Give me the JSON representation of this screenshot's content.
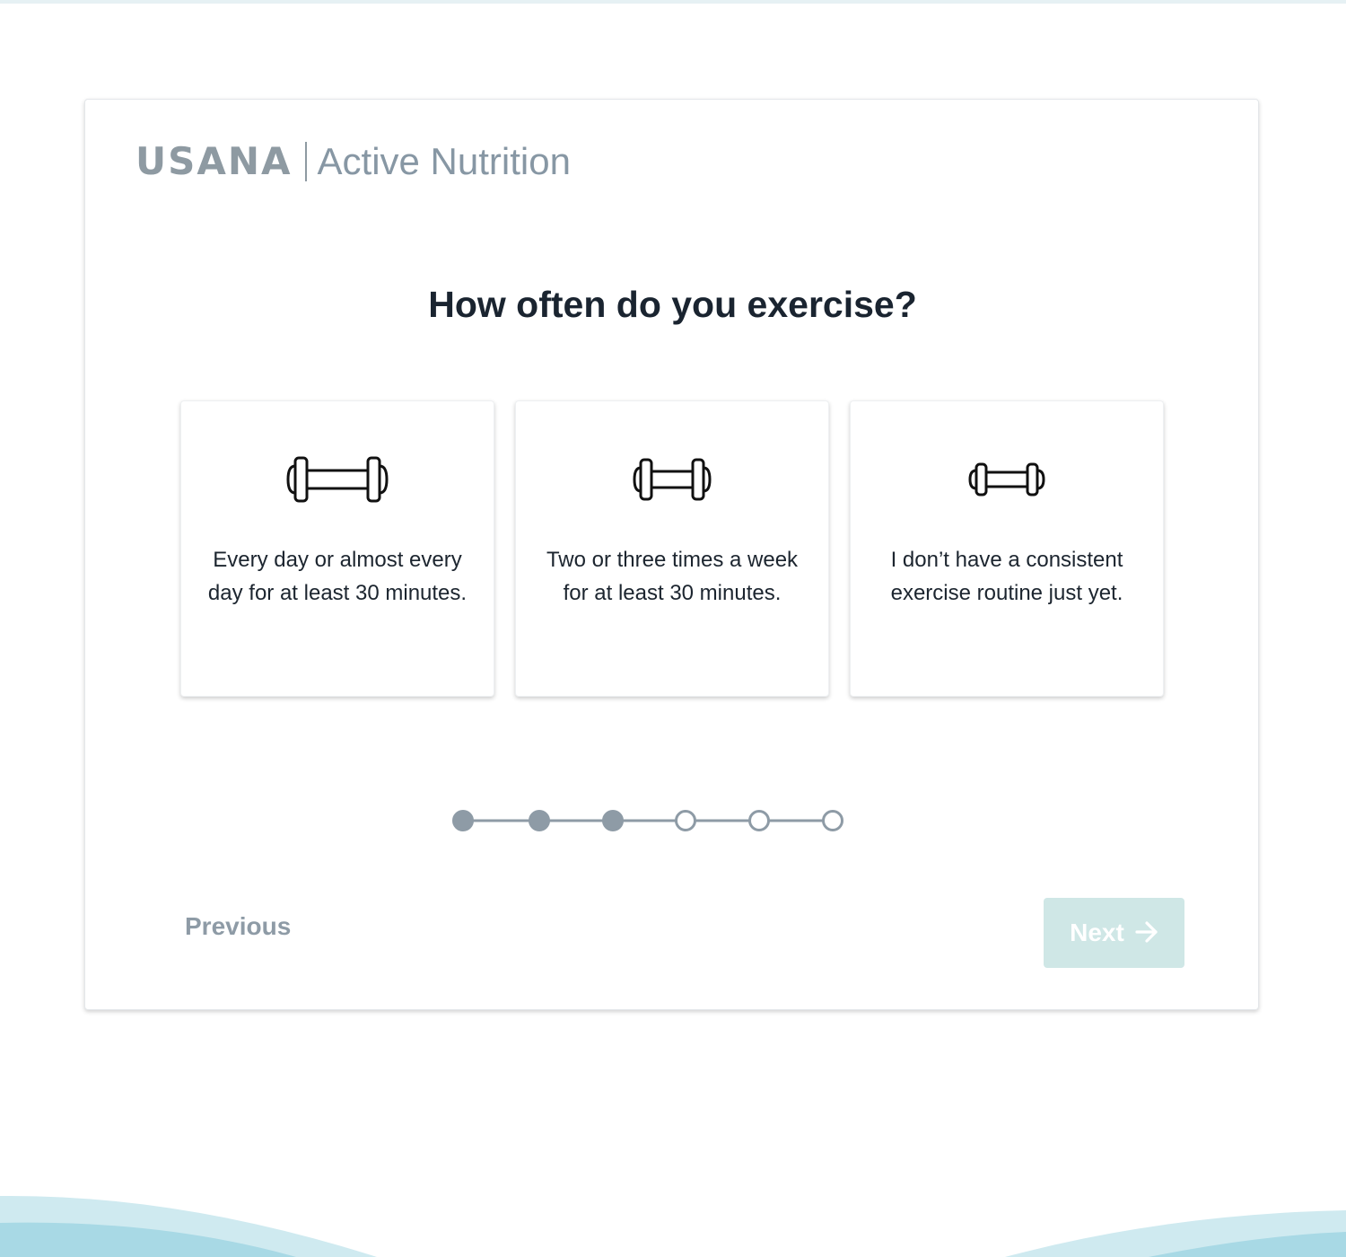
{
  "brand": {
    "logo_text": "USANA",
    "subtitle": "Active Nutrition"
  },
  "question": {
    "title": "How often do you exercise?"
  },
  "options": [
    {
      "icon": "dumbbell-large-icon",
      "label": "Every day or almost every day for at least 30 minutes."
    },
    {
      "icon": "dumbbell-medium-icon",
      "label": "Two or three times a week for at least 30 minutes."
    },
    {
      "icon": "dumbbell-small-icon",
      "label": "I don’t have a consistent exercise routine just yet."
    }
  ],
  "progress": {
    "total_steps": 6,
    "completed_steps": 3
  },
  "navigation": {
    "previous_label": "Previous",
    "next_label": "Next",
    "next_icon": "arrow-right-icon"
  },
  "colors": {
    "accent_disabled": "#cfe7e6",
    "muted_text": "#8e9ba6",
    "step_filled": "#8e9ba6"
  }
}
